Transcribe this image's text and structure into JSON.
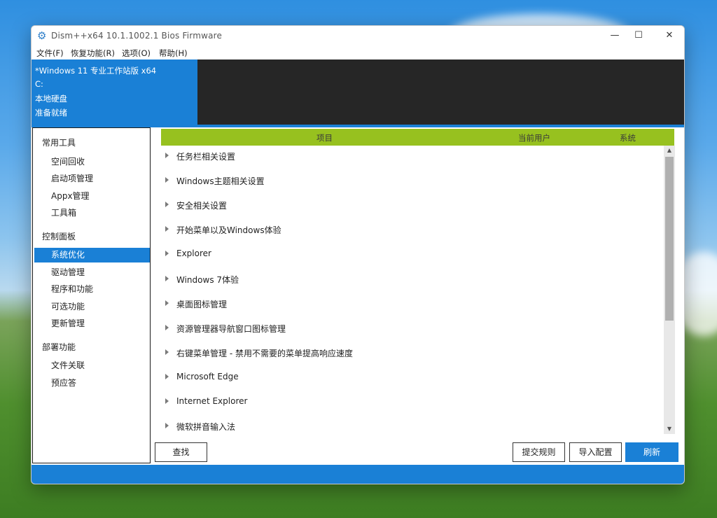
{
  "window": {
    "title": "Dism++x64 10.1.1002.1 Bios Firmware",
    "controls": {
      "minimize": "—",
      "maximize": "☐",
      "close": "✕"
    }
  },
  "menu": [
    "文件(F)",
    "恢复功能(R)",
    "选项(O)",
    "帮助(H)"
  ],
  "info": {
    "os": "*Windows 11 专业工作站版 x64",
    "drive": "C:",
    "disk": "本地硬盘",
    "status": "准备就绪"
  },
  "sidebar": {
    "groups": [
      {
        "label": "常用工具",
        "items": [
          "空间回收",
          "启动项管理",
          "Appx管理",
          "工具箱"
        ]
      },
      {
        "label": "控制面板",
        "items": [
          "系统优化",
          "驱动管理",
          "程序和功能",
          "可选功能",
          "更新管理"
        ]
      },
      {
        "label": "部署功能",
        "items": [
          "文件关联",
          "预应答"
        ]
      }
    ],
    "active_item": "系统优化"
  },
  "table": {
    "headers": {
      "item": "项目",
      "current_user": "当前用户",
      "system": "系统"
    },
    "rows": [
      "任务栏相关设置",
      "Windows主题相关设置",
      "安全相关设置",
      "开始菜单以及Windows体验",
      "Explorer",
      "Windows 7体验",
      "桌面图标管理",
      "资源管理器导航窗口图标管理",
      "右键菜单管理 - 禁用不需要的菜单提高响应速度",
      "Microsoft Edge",
      "Internet Explorer",
      "微软拼音输入法"
    ]
  },
  "buttons": {
    "find": "查找",
    "submit_rules": "提交规则",
    "import_config": "导入配置",
    "refresh": "刷新"
  },
  "colors": {
    "accent": "#1a80d6",
    "header_green": "#97c11f",
    "info_dark": "#262626"
  }
}
